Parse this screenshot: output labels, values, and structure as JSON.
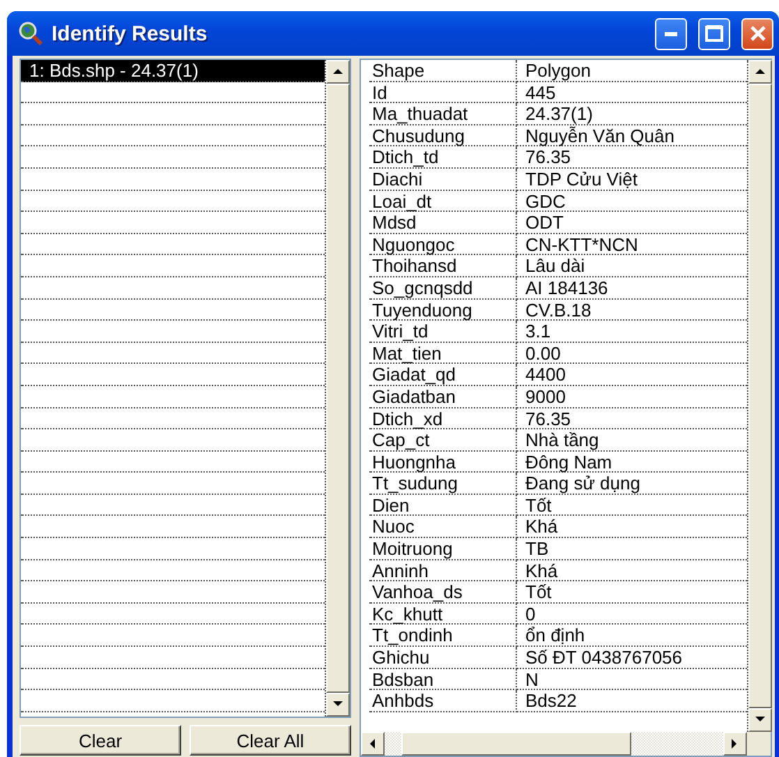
{
  "window": {
    "title": "Identify Results"
  },
  "results": [
    {
      "label": "1:  Bds.shp - 24.37(1)",
      "selected": true
    }
  ],
  "attributes": [
    {
      "field": "Shape",
      "value": "Polygon"
    },
    {
      "field": "Id",
      "value": "445"
    },
    {
      "field": "Ma_thuadat",
      "value": "24.37(1)"
    },
    {
      "field": "Chusudung",
      "value": "Nguyễn Văn Quân"
    },
    {
      "field": "Dtich_td",
      "value": "76.35"
    },
    {
      "field": "Diachi",
      "value": "TDP Cửu Việt"
    },
    {
      "field": "Loai_dt",
      "value": "GDC"
    },
    {
      "field": "Mdsd",
      "value": "ODT"
    },
    {
      "field": "Nguongoc",
      "value": "CN-KTT*NCN"
    },
    {
      "field": "Thoihansd",
      "value": "Lâu dài"
    },
    {
      "field": "So_gcnqsdd",
      "value": "AI 184136"
    },
    {
      "field": "Tuyenduong",
      "value": "CV.B.18"
    },
    {
      "field": "Vitri_td",
      "value": "3.1"
    },
    {
      "field": "Mat_tien",
      "value": "0.00"
    },
    {
      "field": "Giadat_qd",
      "value": "4400"
    },
    {
      "field": "Giadatban",
      "value": "9000"
    },
    {
      "field": "Dtich_xd",
      "value": "76.35"
    },
    {
      "field": "Cap_ct",
      "value": "Nhà tầng"
    },
    {
      "field": "Huongnha",
      "value": "Đông Nam"
    },
    {
      "field": "Tt_sudung",
      "value": "Đang sử dụng"
    },
    {
      "field": "Dien",
      "value": "Tốt"
    },
    {
      "field": "Nuoc",
      "value": "Khá"
    },
    {
      "field": "Moitruong",
      "value": "TB"
    },
    {
      "field": "Anninh",
      "value": "Khá"
    },
    {
      "field": "Vanhoa_ds",
      "value": "Tốt"
    },
    {
      "field": "Kc_khutt",
      "value": "0"
    },
    {
      "field": "Tt_ondinh",
      "value": "ổn định"
    },
    {
      "field": "Ghichu",
      "value": "Số ĐT 0438767056"
    },
    {
      "field": "Bdsban",
      "value": "N"
    },
    {
      "field": "Anhbds",
      "value": "Bds22"
    }
  ],
  "buttons": [
    "Clear",
    "Clear All"
  ]
}
